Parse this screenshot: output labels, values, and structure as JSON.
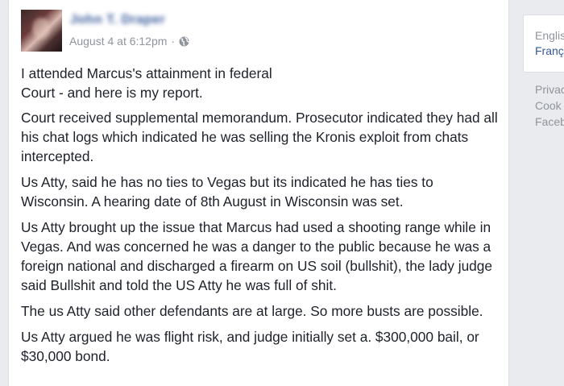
{
  "post": {
    "author": "John T. Draper",
    "timestamp": "August 4 at 6:12pm",
    "separator": "·",
    "privacy_icon": "globe-icon",
    "paragraphs": [
      "I attended Marcus's attainment in federal Court - and here is my report.",
      "Court received supplemental memorandum. Prosecutor indicated they had all his chat logs which indicated he was selling the Kronis exploit from chats intercepted.",
      "Us Atty, said he has no ties to Vegas but its indicated he has ties to Wisconsin. A hearing date of 8th August in Wisconsin was set.",
      "Us Atty brought up the issue that Marcus had used a shooting range while in Vegas. And was concerned he was a danger to the public because he was a foreign national and discharged a firearm on US soil (bullshit), the lady judge said Bullshit and told the US Atty he was full of shit.",
      "The us Atty said other defendants are at large. So more busts are possible.",
      "Us Atty argued he was flight risk, and judge initially set a. $300,000 bail, or $30,000 bond."
    ]
  },
  "sidebar": {
    "language_current": "Englis",
    "language_alt": "Franç",
    "footer_links": [
      "Privac",
      "Cook",
      "Faceb"
    ]
  },
  "colors": {
    "page_bg": "#e9ebee",
    "link": "#365899",
    "meta": "#90949c",
    "text": "#1d2129"
  }
}
